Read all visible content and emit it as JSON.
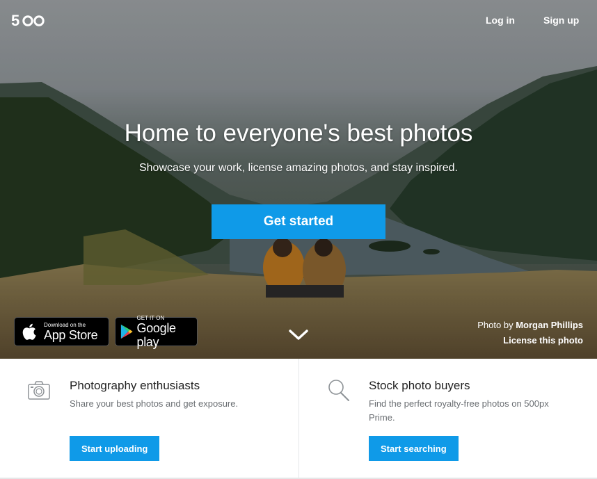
{
  "header": {
    "logo_text": "500",
    "login_label": "Log in",
    "signup_label": "Sign up"
  },
  "hero": {
    "headline": "Home to everyone's best photos",
    "subhead": "Showcase your work, license amazing photos, and stay inspired.",
    "cta_label": "Get started",
    "appstore": {
      "small": "Download on the",
      "big": "App Store"
    },
    "playstore": {
      "small": "GET IT ON",
      "big": "Google play"
    },
    "credit_prefix": "Photo by",
    "credit_name": "Morgan Phillips",
    "license_label": "License this photo"
  },
  "features": [
    {
      "icon": "camera-icon",
      "title": "Photography enthusiasts",
      "description": "Share your best photos and get exposure.",
      "button_label": "Start uploading"
    },
    {
      "icon": "search-icon",
      "title": "Stock photo buyers",
      "description": "Find the perfect royalty-free photos on 500px Prime.",
      "button_label": "Start searching"
    }
  ],
  "colors": {
    "accent": "#0f9ae8",
    "text_dark": "#222222",
    "text_muted": "#6a6e72"
  }
}
